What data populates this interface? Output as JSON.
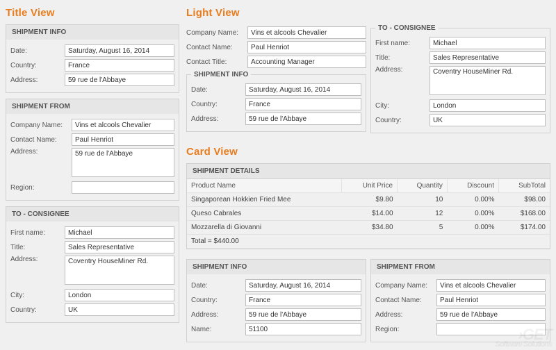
{
  "titleView": {
    "heading": "Title View",
    "shipmentInfo": {
      "title": "SHIPMENT INFO",
      "fields": {
        "dateLabel": "Date:",
        "date": "Saturday, August 16, 2014",
        "countryLabel": "Country:",
        "country": "France",
        "addressLabel": "Address:",
        "address": "59 rue de l'Abbaye"
      }
    },
    "shipmentFrom": {
      "title": "SHIPMENT FROM",
      "fields": {
        "companyLabel": "Company Name:",
        "company": "Vins et alcools Chevalier",
        "contactLabel": "Contact Name:",
        "contact": "Paul Henriot",
        "addressLabel": "Address:",
        "address": "59 rue de l'Abbaye",
        "regionLabel": "Region:",
        "region": ""
      }
    },
    "toConsignee": {
      "title": "TO - CONSIGNEE",
      "fields": {
        "firstNameLabel": "First name:",
        "firstName": "Michael",
        "titleLabel": "Title:",
        "title": "Sales Representative",
        "addressLabel": "Address:",
        "address": "Coventry HouseMiner Rd.",
        "cityLabel": "City:",
        "city": "London",
        "countryLabel": "Country:",
        "country": "UK"
      }
    }
  },
  "lightView": {
    "heading": "Light View",
    "top": {
      "companyLabel": "Company Name:",
      "company": "Vins et alcools Chevalier",
      "contactLabel": "Contact Name:",
      "contact": "Paul Henriot",
      "contactTitleLabel": "Contact Title:",
      "contactTitle": "Accounting Manager"
    },
    "shipmentInfo": {
      "title": "SHIPMENT INFO",
      "fields": {
        "dateLabel": "Date:",
        "date": "Saturday, August 16, 2014",
        "countryLabel": "Country:",
        "country": "France",
        "addressLabel": "Address:",
        "address": "59 rue de l'Abbaye"
      }
    },
    "toConsignee": {
      "title": "TO - CONSIGNEE",
      "fields": {
        "firstNameLabel": "First name:",
        "firstName": "Michael",
        "titleLabel": "Title:",
        "title": "Sales Representative",
        "addressLabel": "Address:",
        "address": "Coventry HouseMiner Rd.",
        "cityLabel": "City:",
        "city": "London",
        "countryLabel": "Country:",
        "country": "UK"
      }
    }
  },
  "cardView": {
    "heading": "Card View",
    "details": {
      "title": "SHIPMENT DETAILS",
      "columns": {
        "product": "Product Name",
        "unitPrice": "Unit Price",
        "quantity": "Quantity",
        "discount": "Discount",
        "subtotal": "SubTotal"
      },
      "rows": [
        {
          "product": "Singaporean Hokkien Fried Mee",
          "unitPrice": "$9.80",
          "quantity": "10",
          "discount": "0.00%",
          "subtotal": "$98.00"
        },
        {
          "product": "Queso Cabrales",
          "unitPrice": "$14.00",
          "quantity": "12",
          "discount": "0.00%",
          "subtotal": "$168.00"
        },
        {
          "product": "Mozzarella di Giovanni",
          "unitPrice": "$34.80",
          "quantity": "5",
          "discount": "0.00%",
          "subtotal": "$174.00"
        }
      ],
      "totalLabel": "Total = $440.00"
    },
    "shipmentInfo": {
      "title": "SHIPMENT INFO",
      "fields": {
        "dateLabel": "Date:",
        "date": "Saturday, August 16, 2014",
        "countryLabel": "Country:",
        "country": "France",
        "addressLabel": "Address:",
        "address": "59 rue de l'Abbaye",
        "nameLabel": "Name:",
        "name": "51100"
      }
    },
    "shipmentFrom": {
      "title": "SHIPMENT FROM",
      "fields": {
        "companyLabel": "Company Name:",
        "company": "Vins et alcools Chevalier",
        "contactLabel": "Contact Name:",
        "contact": "Paul Henriot",
        "addressLabel": "Address:",
        "address": "59 rue de l'Abbaye",
        "regionLabel": "Region:",
        "region": ""
      }
    }
  }
}
